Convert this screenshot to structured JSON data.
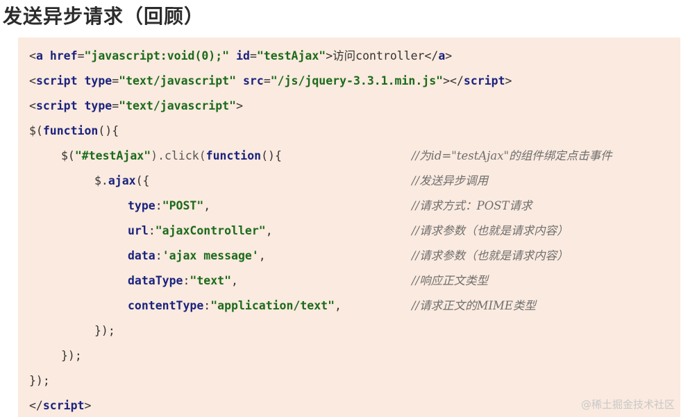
{
  "title": "发送异步请求（回顾）",
  "code": {
    "l1": {
      "t1": "<",
      "t2": "a",
      "t3": " ",
      "t4": "href",
      "t5": "=",
      "t6": "\"javascript:void(0);\"",
      "t7": " ",
      "t8": "id",
      "t9": "=",
      "t10": "\"testAjax\"",
      "t11": ">访问controller</",
      "t12": "a",
      "t13": ">"
    },
    "l2": {
      "t1": "<",
      "t2": "script",
      "t3": " ",
      "t4": "type",
      "t5": "=",
      "t6": "\"text/javascript\"",
      "t7": " ",
      "t8": "src",
      "t9": "=",
      "t10": "\"/js/jquery-3.3.1.min.js\"",
      "t11": "></",
      "t12": "script",
      "t13": ">"
    },
    "l3": {
      "t1": "<",
      "t2": "script",
      "t3": " ",
      "t4": "type",
      "t5": "=",
      "t6": "\"text/javascript\"",
      "t7": ">"
    },
    "l4": {
      "t1": "$(",
      "t2": "function",
      "t3": "(){"
    },
    "l5": {
      "t1": "$(",
      "t2": "\"#testAjax\"",
      "t3": ").click(",
      "t4": "function",
      "t5": "(){"
    },
    "l6": {
      "t1": "$.",
      "t2": "ajax",
      "t3": "({"
    },
    "l7": {
      "key": "type",
      "colon": ":",
      "val": "\"POST\"",
      "comma": ","
    },
    "l8": {
      "key": "url",
      "colon": ":",
      "val": "\"ajaxController\"",
      "comma": ","
    },
    "l9": {
      "key": "data",
      "colon": ":",
      "val": "'ajax message'",
      "comma": ","
    },
    "l10": {
      "key": "dataType",
      "colon": ":",
      "val": "\"text\"",
      "comma": ","
    },
    "l11": {
      "key": "contentType",
      "colon": ":",
      "val": "\"application/text\"",
      "comma": ","
    },
    "l12": "});",
    "l13": "});",
    "l14": "});",
    "l15": {
      "t1": "</",
      "t2": "script",
      "t3": ">"
    }
  },
  "comments": {
    "c5": "//为id=\"testAjax\"的组件绑定点击事件",
    "c6": "//发送异步调用",
    "c7": "//请求方式：POST请求",
    "c8": "//请求参数（也就是请求内容）",
    "c9": "//请求参数（也就是请求内容）",
    "c10": "//响应正文类型",
    "c11": "//请求正文的MIME类型"
  },
  "watermark": "@稀土掘金技术社区",
  "colors": {
    "panel_background": "#fbeadf",
    "keyword": "#1a237e",
    "string": "#1b6b1b",
    "comment": "#6f6f6f"
  }
}
